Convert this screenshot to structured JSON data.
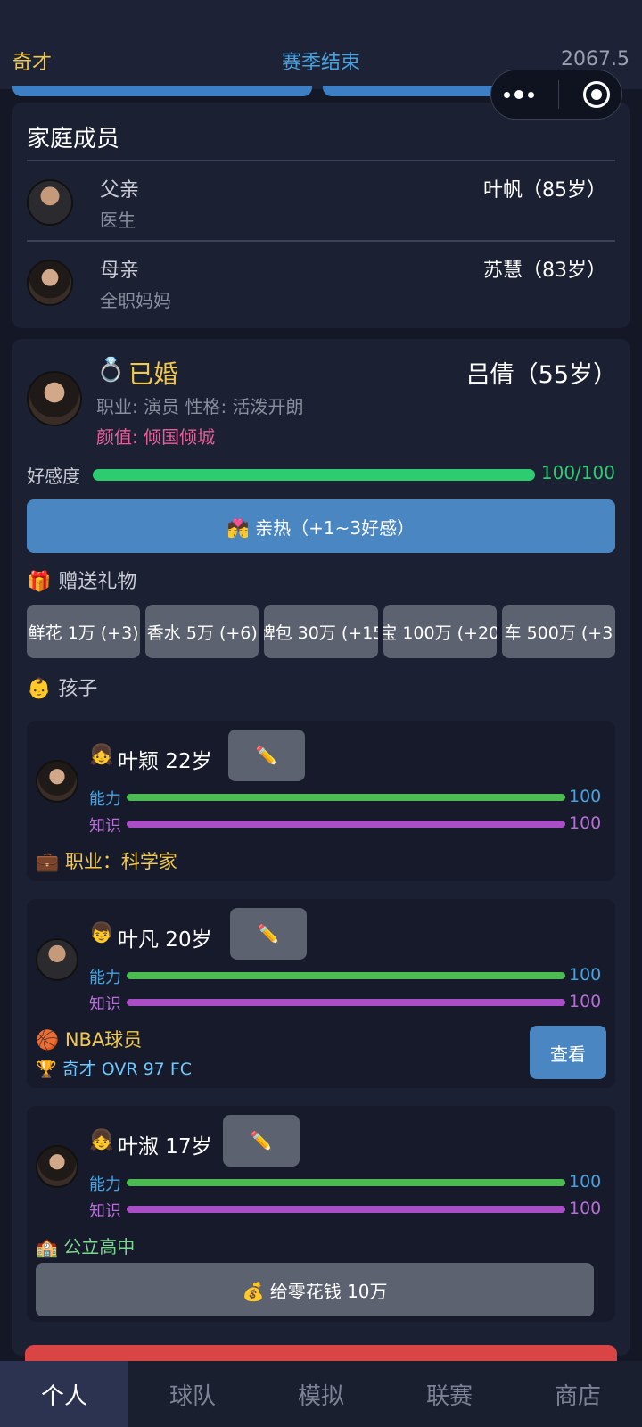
{
  "header": {
    "left": "奇才",
    "center": "赛季结束",
    "right": "2067.5"
  },
  "family": {
    "title": "家庭成员",
    "members": [
      {
        "role": "父亲",
        "job": "医生",
        "name": "叶帆（85岁）"
      },
      {
        "role": "母亲",
        "job": "全职妈妈",
        "name": "苏慧（83岁）"
      }
    ]
  },
  "spouse": {
    "ring_icon": "💍",
    "status": "已婚",
    "name": "吕倩（55岁）",
    "info": "职业: 演员   性格: 活泼开朗",
    "looks": "颜值: 倾国倾城",
    "affection_label": "好感度",
    "affection_value": "100/100",
    "affection_ratio": 1.0,
    "intimate_button": "💏 亲热（+1~3好感）",
    "gift_icon": "🎁",
    "gift_title": "赠送礼物",
    "gifts": [
      "鲜花 1万 (+3)",
      "香水 5万 (+6)",
      "牌包 30万 (+15",
      "宝 100万 (+20",
      "车 500万 (+3"
    ],
    "children_icon": "👶",
    "children_title": "孩子"
  },
  "children": [
    {
      "icon": "👧",
      "name": "叶颖  22岁",
      "edit": "✏️",
      "ability_label": "能力",
      "ability_value": "100",
      "knowledge_label": "知识",
      "knowledge_value": "100",
      "extra": "💼 职业：科学家"
    },
    {
      "icon": "👦",
      "name": "叶凡  20岁",
      "edit": "✏️",
      "ability_label": "能力",
      "ability_value": "100",
      "knowledge_label": "知识",
      "knowledge_value": "100",
      "extra": "🏀 NBA球员",
      "extra2": "🏆 奇才  OVR 97  FC",
      "view_button": "查看"
    },
    {
      "icon": "👧",
      "name": "叶淑  17岁",
      "edit": "✏️",
      "ability_label": "能力",
      "ability_value": "100",
      "knowledge_label": "知识",
      "knowledge_value": "100",
      "extra": "🏫 公立高中",
      "money_button": "💰 给零花钱 10万"
    }
  ],
  "tabs": [
    "个人",
    "球队",
    "模拟",
    "联赛",
    "商店"
  ],
  "colors": {
    "accent_blue": "#4a86c2",
    "gold": "#f2c94c",
    "green": "#2ecc71",
    "danger": "#d94545"
  }
}
